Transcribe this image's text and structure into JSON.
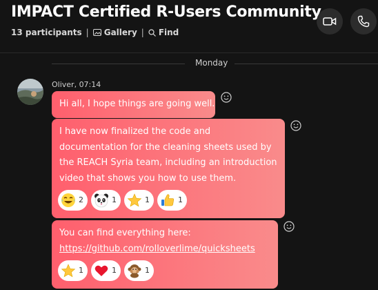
{
  "header": {
    "title": "IMPACT Certified R-Users Community",
    "participants": "13 participants",
    "gallery": "Gallery",
    "find": "Find",
    "separator": "|"
  },
  "day_label": "Monday",
  "message": {
    "sender": "Oliver, 07:14",
    "bubble1": "Hi all, I hope things are going well.",
    "bubble2": "I have now finalized the code and documentation for the cleaning sheets used by the REACH Syria team, including an introduction video that shows you how to use them.",
    "bubble3_text": "You can find everything here: ",
    "bubble3_link": "https://github.com/rolloverlime/quicksheets",
    "reactions2": [
      {
        "icon": "laugh-emoji",
        "count": "2"
      },
      {
        "icon": "panda-emoji",
        "count": "1"
      },
      {
        "icon": "star-emoji",
        "count": "1"
      },
      {
        "icon": "thumbs-up-emoji",
        "count": "1"
      }
    ],
    "reactions3": [
      {
        "icon": "star-emoji",
        "count": "1"
      },
      {
        "icon": "heart-emoji",
        "count": "1"
      },
      {
        "icon": "monkey-emoji",
        "count": "1"
      }
    ]
  },
  "colors": {
    "background": "#141414",
    "bubble_start": "#ff5f6d",
    "bubble_end": "#f98b8b"
  }
}
